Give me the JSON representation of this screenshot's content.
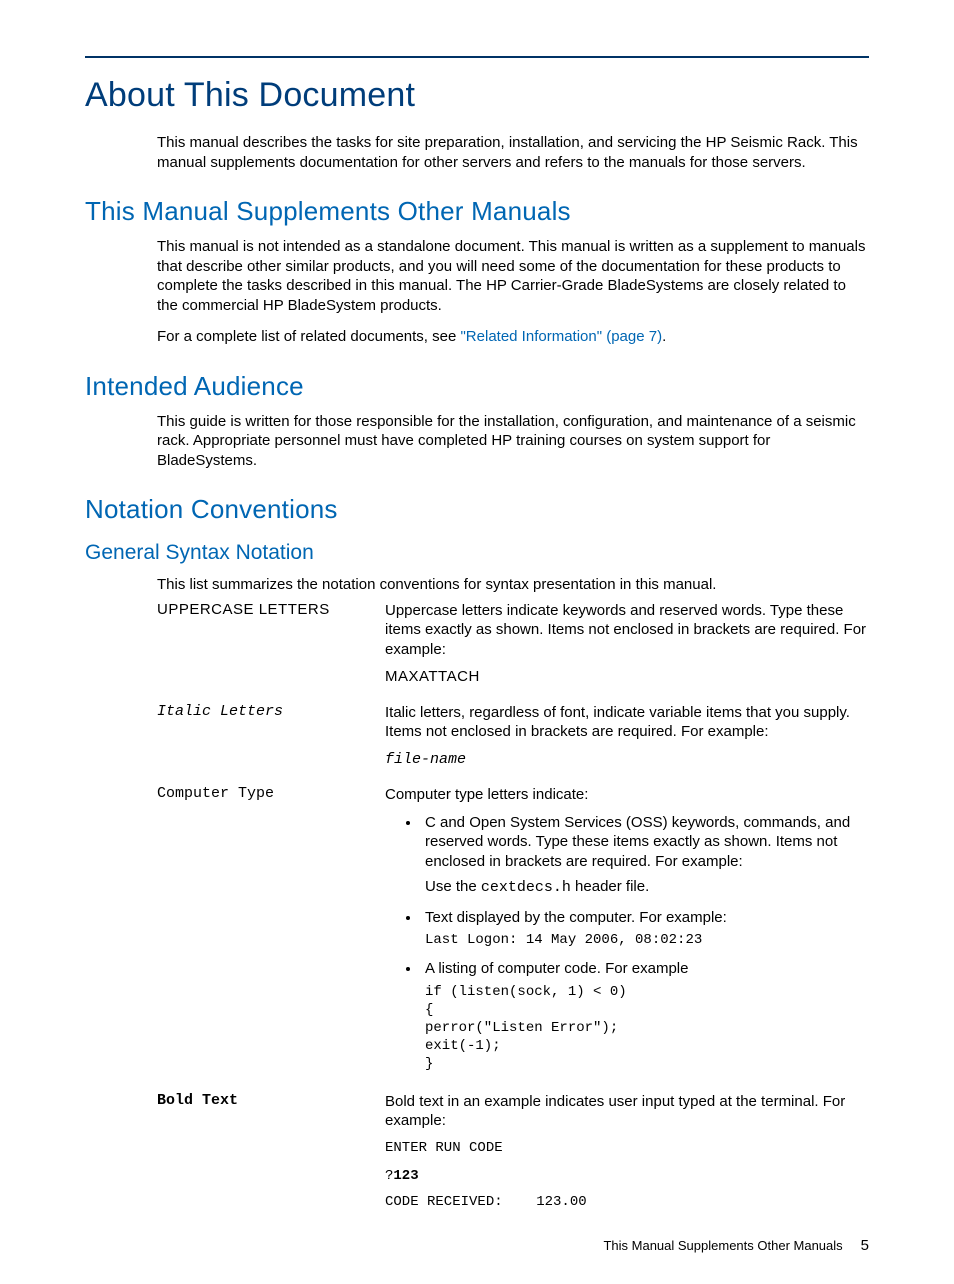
{
  "title": "About This Document",
  "intro": "This manual describes the tasks for site preparation, installation, and servicing the HP Seismic Rack. This manual supplements documentation for other servers and refers to the manuals for those servers.",
  "sections": {
    "supplements": {
      "heading": "This Manual Supplements Other Manuals",
      "p1": "This manual is not intended as a standalone document. This manual is written as a supplement to manuals that describe other similar products, and you will need some of the documentation for these products to complete the tasks described in this manual. The HP Carrier-Grade BladeSystems are closely related to the commercial HP BladeSystem products.",
      "p2_pre": "For a complete list of related documents, see ",
      "p2_link": "\"Related Information\" (page 7)",
      "p2_post": "."
    },
    "audience": {
      "heading": "Intended Audience",
      "p1": "This guide is written for those responsible for the installation, configuration, and maintenance of a seismic rack. Appropriate personnel must have completed HP training courses on system support for BladeSystems."
    },
    "notation": {
      "heading": "Notation Conventions",
      "sub_heading": "General Syntax Notation",
      "intro": "This list summarizes the notation conventions for syntax presentation in this manual.",
      "rows": {
        "uppercase": {
          "term": "UPPERCASE LETTERS",
          "def": "Uppercase letters indicate keywords and reserved words. Type these items exactly as shown. Items not enclosed in brackets are required. For example:",
          "example": "MAXATTACH"
        },
        "italic": {
          "term": "Italic Letters",
          "def": "Italic letters, regardless of font, indicate variable items that you supply. Items not enclosed in brackets are required. For example:",
          "example": "file-name"
        },
        "computer": {
          "term": "Computer Type",
          "def_intro": "Computer type letters indicate:",
          "b1": "C and Open System Services (OSS) keywords, commands, and reserved words. Type these items exactly as shown. Items not enclosed in brackets are required. For example:",
          "b1_use_pre": "Use the ",
          "b1_use_code": "cextdecs.h",
          "b1_use_post": " header file.",
          "b2": "Text displayed by the computer. For example:",
          "b2_example": "Last Logon: 14 May 2006, 08:02:23",
          "b3": "A listing of computer code. For example",
          "b3_example": "if (listen(sock, 1) < 0)\n{\nperror(\"Listen Error\");\nexit(-1);\n}"
        },
        "bold": {
          "term": "Bold Text",
          "def": "Bold text in an example indicates user input typed at the terminal. For example:",
          "ex1": "ENTER RUN CODE",
          "ex2_q": "?",
          "ex2_b": "123",
          "ex3": "CODE RECEIVED:    123.00"
        }
      }
    }
  },
  "footer": {
    "text": "This Manual Supplements Other Manuals",
    "page": "5"
  }
}
